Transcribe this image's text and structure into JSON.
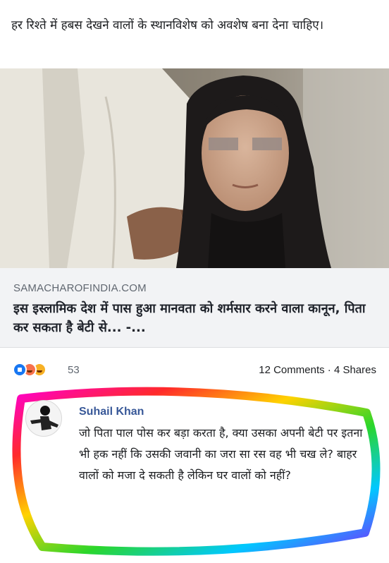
{
  "post": {
    "text": "हर रिश्ते में हबस देखने वालों के स्थानविशेष को अवशेष बना देना चाहिए।"
  },
  "link": {
    "domain": "SAMACHAROFINDIA.COM",
    "title": "इस इस्लामिक देश में पास हुआ मानवता को शर्मसार करने वाला कानून, पिता कर सकता है बेटी से... -..."
  },
  "reactions": {
    "icons": [
      "like-icon",
      "angry-icon",
      "haha-icon"
    ],
    "count": "53",
    "engagement": "12 Comments · 4 Shares"
  },
  "comment": {
    "author": "Suhail Khan",
    "text": "जो पिता पाल पोस कर बड़ा करता है, क्या उसका अपनी बेटी पर इतना भी हक नहीं कि उसकी जवानी का जरा सा रस वह भी चख ले? बाहर वालों को मजा दे सकती है लेकिन घर वालों को नहीं?"
  },
  "colors": {
    "link_box_bg": "#f2f3f5",
    "author_blue": "#385898",
    "like_blue": "#1877f2"
  }
}
